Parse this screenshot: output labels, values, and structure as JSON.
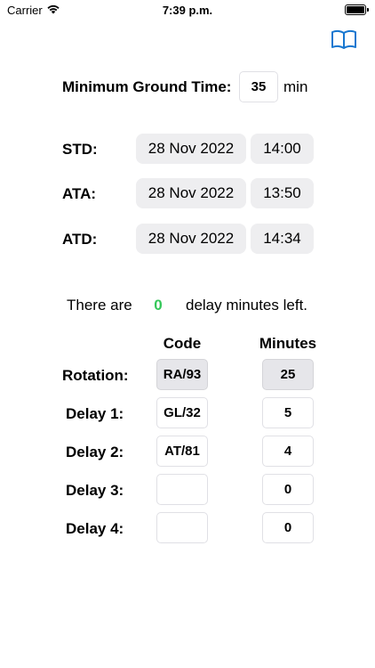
{
  "status": {
    "carrier": "Carrier",
    "time": "7:39 p.m."
  },
  "accent_color": "#1877d0",
  "icons": {
    "toolbar": "book-icon",
    "wifi": "wifi-icon",
    "battery": "battery-icon"
  },
  "ground_time": {
    "label": "Minimum Ground Time:",
    "value": "35",
    "unit": "min"
  },
  "schedule": [
    {
      "label": "STD:",
      "date": "28 Nov 2022",
      "time": "14:00"
    },
    {
      "label": "ATA:",
      "date": "28 Nov 2022",
      "time": "13:50"
    },
    {
      "label": "ATD:",
      "date": "28 Nov 2022",
      "time": "14:34"
    }
  ],
  "delay_summary": {
    "prefix": "There are",
    "count": "0",
    "suffix": "delay minutes left.",
    "count_color": "#34c759"
  },
  "delay_table": {
    "headers": {
      "code": "Code",
      "minutes": "Minutes"
    },
    "rows": [
      {
        "label": "Rotation:",
        "code": "RA/93",
        "minutes": "25"
      },
      {
        "label": "Delay 1:",
        "code": "GL/32",
        "minutes": "5"
      },
      {
        "label": "Delay 2:",
        "code": "AT/81",
        "minutes": "4"
      },
      {
        "label": "Delay 3:",
        "code": "",
        "minutes": "0"
      },
      {
        "label": "Delay 4:",
        "code": "",
        "minutes": "0"
      }
    ]
  }
}
